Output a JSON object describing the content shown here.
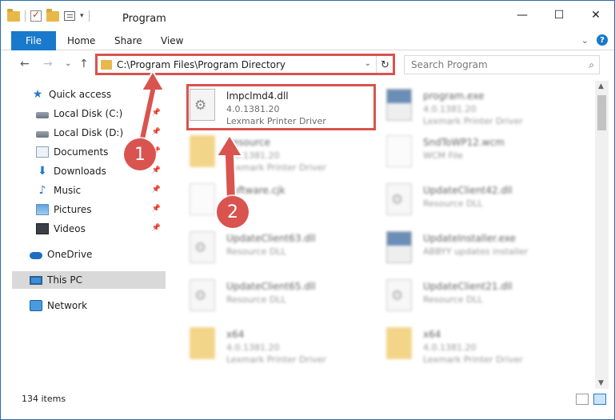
{
  "window": {
    "title": "Program",
    "controls": {
      "minimize": "—",
      "maximize": "☐",
      "close": "✕"
    }
  },
  "ribbon": {
    "tabs": [
      "File",
      "Home",
      "Share",
      "View"
    ],
    "expand": "⌄",
    "help": "?"
  },
  "navigation": {
    "back": "←",
    "forward": "→",
    "recent": "⌄",
    "up": "↑",
    "address": "C:\\Program Files\\Program Directory",
    "address_dropdown": "⌄",
    "refresh": "↻",
    "search_placeholder": "Search Program",
    "search_icon": "⌕"
  },
  "sidebar": {
    "items": [
      {
        "label": "Quick access",
        "icon": "star-icon",
        "pinned": false
      },
      {
        "label": "Local Disk (C:)",
        "icon": "drive-icon",
        "pinned": true
      },
      {
        "label": "Local Disk (D:)",
        "icon": "drive-icon",
        "pinned": true
      },
      {
        "label": "Documents",
        "icon": "documents-icon",
        "pinned": true
      },
      {
        "label": "Downloads",
        "icon": "downloads-icon",
        "pinned": true
      },
      {
        "label": "Music",
        "icon": "music-icon",
        "pinned": true
      },
      {
        "label": "Pictures",
        "icon": "pictures-icon",
        "pinned": true
      },
      {
        "label": "Videos",
        "icon": "videos-icon",
        "pinned": true
      },
      {
        "label": "OneDrive",
        "icon": "onedrive-icon",
        "pinned": false
      },
      {
        "label": "This PC",
        "icon": "this-pc-icon",
        "pinned": false,
        "selected": true
      },
      {
        "label": "Network",
        "icon": "network-icon",
        "pinned": false
      }
    ],
    "pin_glyph": "📌"
  },
  "files": [
    {
      "name": "lmpclmd4.dll",
      "line1": "4.0.1381.20",
      "line2": "Lexmark Printer Driver",
      "icon": "dll-file-icon",
      "highlighted": true
    },
    {
      "name": "program.exe",
      "line1": "4.0.1381.20",
      "line2": "Lexmark Printer Driver",
      "icon": "exe-file-icon"
    },
    {
      "name": "Resource",
      "line1": "4.0.1381.20",
      "line2": "Lexmark Printer Driver",
      "icon": "folder-icon"
    },
    {
      "name": "SndToWP12.wcm",
      "line1": "WCM File",
      "line2": "",
      "icon": "blank-file-icon"
    },
    {
      "name": "Software.cjk",
      "line1": "",
      "line2": "",
      "icon": "blank-file-icon"
    },
    {
      "name": "UpdateClient42.dll",
      "line1": "Resource DLL",
      "line2": "",
      "icon": "dll-file-icon"
    },
    {
      "name": "UpdateClient63.dll",
      "line1": "Resource DLL",
      "line2": "",
      "icon": "dll-file-icon"
    },
    {
      "name": "UpdateInstaller.exe",
      "line1": "ABBYY updates installer",
      "line2": "",
      "icon": "exe-file-icon"
    },
    {
      "name": "UpdateClient65.dll",
      "line1": "Resource DLL",
      "line2": "",
      "icon": "dll-file-icon"
    },
    {
      "name": "UpdateClient21.dll",
      "line1": "Resource DLL",
      "line2": "",
      "icon": "dll-file-icon"
    },
    {
      "name": "x64",
      "line1": "4.0.1381.20",
      "line2": "Lexmark Printer Driver",
      "icon": "folder-icon"
    },
    {
      "name": "x64",
      "line1": "4.0.1381.20",
      "line2": "Lexmark Printer Driver",
      "icon": "folder-icon"
    }
  ],
  "status": {
    "item_count": "134 items"
  },
  "annotations": {
    "step1": "1",
    "step2": "2",
    "color": "#d9534f"
  }
}
